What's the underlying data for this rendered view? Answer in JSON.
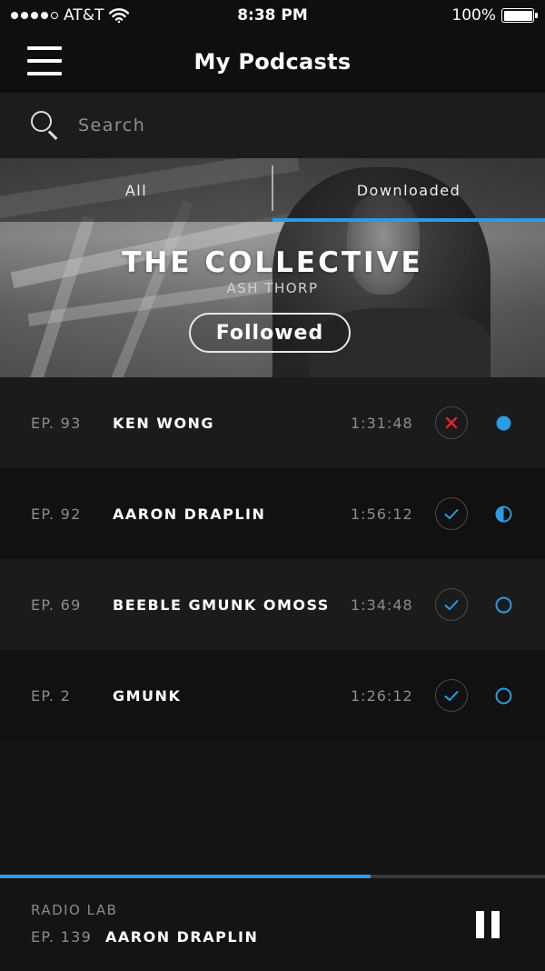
{
  "status_bar": {
    "carrier": "AT&T",
    "time": "8:38 PM",
    "battery": "100%",
    "signal_dots_filled": 4,
    "signal_dots_total": 5
  },
  "nav": {
    "title": "My Podcasts"
  },
  "search": {
    "placeholder": "Search"
  },
  "tabs": [
    {
      "label": "All",
      "active": false
    },
    {
      "label": "Downloaded",
      "active": true
    }
  ],
  "hero": {
    "title": "THE COLLECTIVE",
    "author": "ASH THORP",
    "follow_label": "Followed"
  },
  "episodes": [
    {
      "number": "EP. 93",
      "name": "KEN WONG",
      "duration": "1:31:48",
      "action": "close-icon",
      "status": "filled-dot-icon"
    },
    {
      "number": "EP. 92",
      "name": "AARON DRAPLIN",
      "duration": "1:56:12",
      "action": "check-icon",
      "status": "half-circle-icon"
    },
    {
      "number": "EP. 69",
      "name": "BEEBLE GMUNK OMOSS",
      "duration": "1:34:48",
      "action": "check-icon",
      "status": "empty-circle-icon"
    },
    {
      "number": "EP. 2",
      "name": "GMUNK",
      "duration": "1:26:12",
      "action": "check-icon",
      "status": "empty-circle-icon"
    }
  ],
  "player": {
    "show": "RADIO LAB",
    "episode_number": "EP. 139",
    "episode_name": "AARON DRAPLIN",
    "progress": 0.68
  },
  "colors": {
    "accent": "#2b9be6",
    "delete": "#e0242e",
    "background": "#141414"
  }
}
